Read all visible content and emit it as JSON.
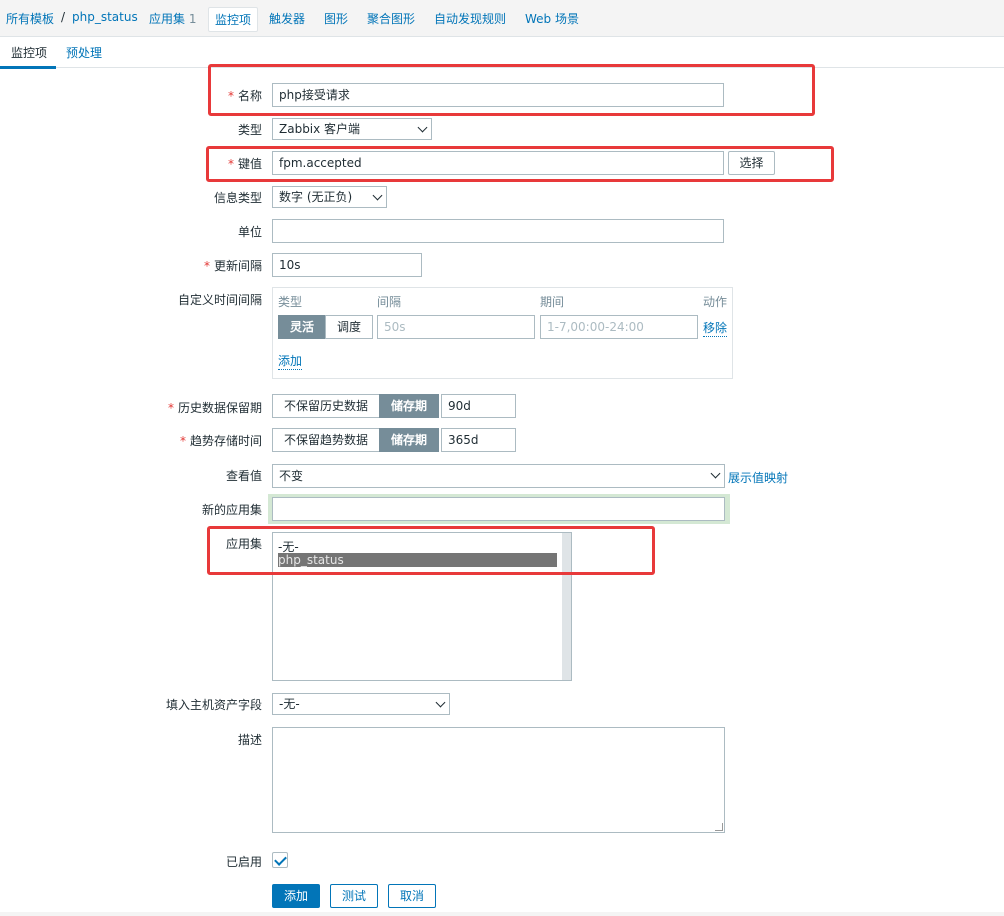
{
  "breadcrumb": {
    "all_templates": "所有模板",
    "separator": "/",
    "template": "php_status",
    "applications": "应用集",
    "applications_count": "1",
    "items": "监控项",
    "triggers": "触发器",
    "graphs": "图形",
    "screens": "聚合图形",
    "discovery": "自动发现规则",
    "web": "Web 场景"
  },
  "tabs": {
    "item": "监控项",
    "preprocessing": "预处理"
  },
  "form": {
    "required_mark": "*",
    "name": {
      "label": "名称",
      "value": "php接受请求"
    },
    "type": {
      "label": "类型",
      "value": "Zabbix 客户端"
    },
    "key": {
      "label": "键值",
      "value": "fpm.accepted",
      "select_button": "选择"
    },
    "info_type": {
      "label": "信息类型",
      "value": "数字 (无正负)"
    },
    "units": {
      "label": "单位",
      "value": ""
    },
    "update_interval": {
      "label": "更新间隔",
      "value": "10s"
    },
    "custom_intervals": {
      "label": "自定义时间间隔",
      "headers": {
        "type": "类型",
        "interval": "间隔",
        "period": "期间",
        "action": "动作"
      },
      "row": {
        "flexible": "灵活",
        "scheduling": "调度",
        "interval_placeholder": "50s",
        "period_placeholder": "1-7,00:00-24:00",
        "remove": "移除"
      },
      "add": "添加"
    },
    "history": {
      "label": "历史数据保留期",
      "option_none": "不保留历史数据",
      "option_storage": "储存期",
      "value": "90d"
    },
    "trends": {
      "label": "趋势存储时间",
      "option_none": "不保留趋势数据",
      "option_storage": "储存期",
      "value": "365d"
    },
    "show_value": {
      "label": "查看值",
      "value": "不变",
      "link": "展示值映射"
    },
    "new_application": {
      "label": "新的应用集",
      "value": ""
    },
    "applications": {
      "label": "应用集",
      "options": [
        "-无-",
        "php_status"
      ],
      "selected": "php_status"
    },
    "inventory": {
      "label": "填入主机资产字段",
      "value": "-无-"
    },
    "description": {
      "label": "描述",
      "value": ""
    },
    "enabled": {
      "label": "已启用",
      "checked": true
    }
  },
  "buttons": {
    "add": "添加",
    "test": "测试",
    "cancel": "取消"
  },
  "colors": {
    "accent": "#0275b8",
    "highlight": "#e8393a",
    "required": "#e33734",
    "segment_active": "#768d99"
  }
}
